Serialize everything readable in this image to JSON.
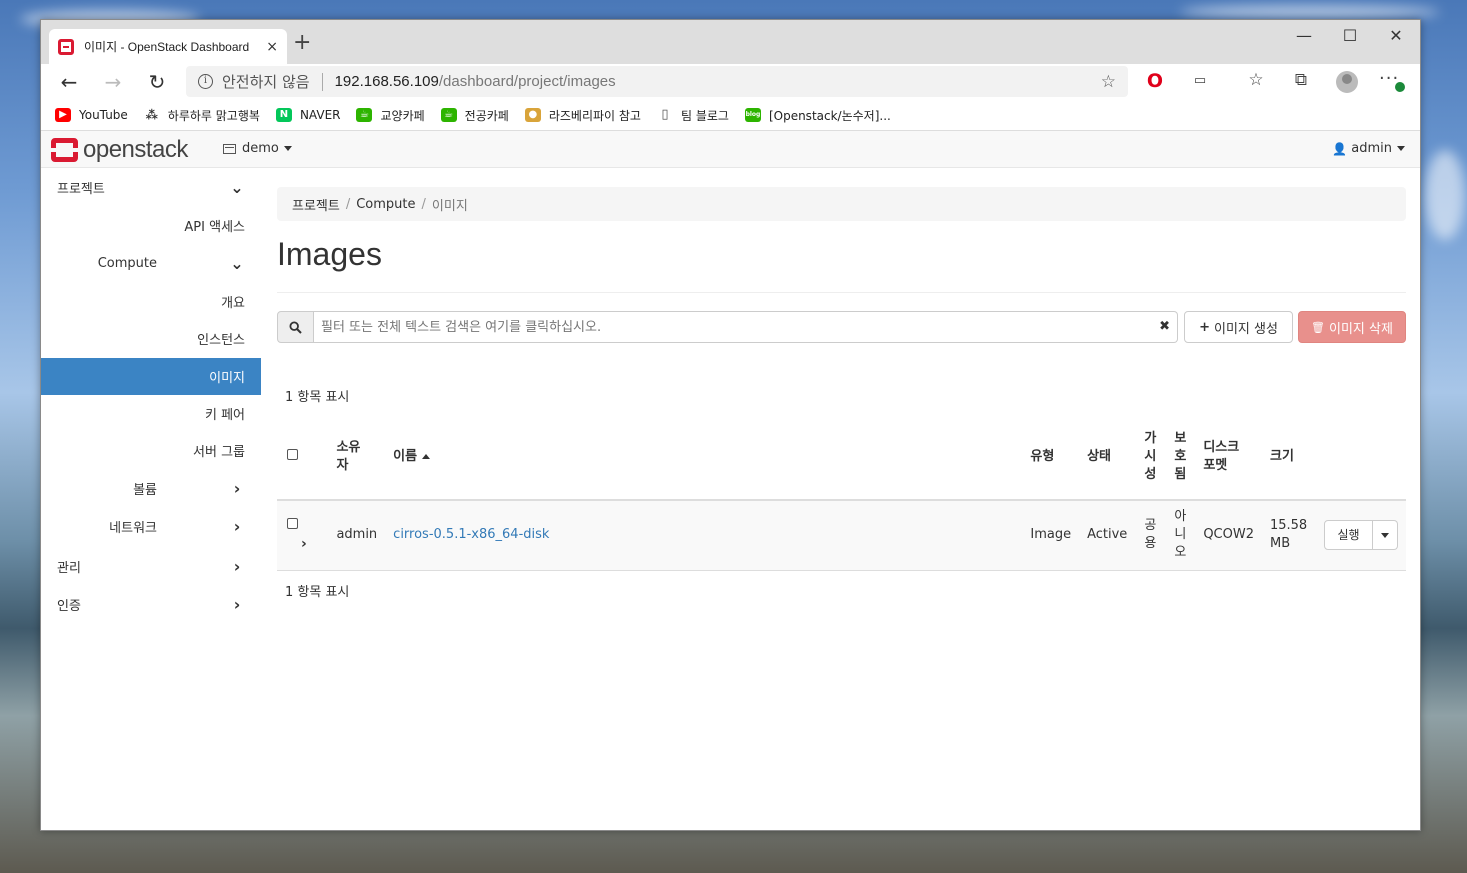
{
  "browser": {
    "tab_title": "이미지 - OpenStack Dashboard",
    "tab_close": "×",
    "new_tab": "+",
    "security_label": "안전하지 않음",
    "url_host": "192.168.56.109",
    "url_path": "/dashboard/project/images",
    "window_controls": {
      "minimize": "—",
      "maximize": "☐",
      "close": "✕"
    }
  },
  "bookmarks": [
    {
      "label": "YouTube",
      "icon": "youtube-icon",
      "color": "#ff0000"
    },
    {
      "label": "하루하루 맑고행복",
      "icon": "bookmark-icon",
      "color": "#333333"
    },
    {
      "label": "NAVER",
      "icon": "naver-icon",
      "color": "#03c75a"
    },
    {
      "label": "교양카페",
      "icon": "cafe-icon",
      "color": "#2db400"
    },
    {
      "label": "전공카페",
      "icon": "cafe-icon",
      "color": "#2db400"
    },
    {
      "label": "라즈베리파이 참고",
      "icon": "raspberry-icon",
      "color": "#d9a43a"
    },
    {
      "label": "팀 블로그",
      "icon": "page-icon",
      "color": "#555555"
    },
    {
      "label": "[Openstack/논수저]...",
      "icon": "blog-icon",
      "color": "#2db400"
    }
  ],
  "header": {
    "logo_text": "openstack",
    "project": "demo",
    "user": "admin"
  },
  "sidebar": {
    "project": "프로젝트",
    "api_access": "API 액세스",
    "compute": "Compute",
    "overview": "개요",
    "instances": "인스턴스",
    "images": "이미지",
    "keypairs": "키 페어",
    "server_groups": "서버 그룹",
    "volumes": "볼륨",
    "network": "네트워크",
    "admin": "관리",
    "identity": "인증"
  },
  "breadcrumb": {
    "project": "프로젝트",
    "compute": "Compute",
    "current": "이미지",
    "separator": "/"
  },
  "page": {
    "title": "Images",
    "search_placeholder": "필터 또는 전체 텍스트 검색은 여기를 클릭하십시오.",
    "create_button": "이미지 생성",
    "delete_button": "이미지 삭제",
    "count_top": "1 항목 표시",
    "count_bottom": "1 항목 표시"
  },
  "table": {
    "headers": {
      "owner": "소유자",
      "name": "이름",
      "type": "유형",
      "status": "상태",
      "visibility": "가시성",
      "protected": "보호됨",
      "disk_format": "디스크 포멧",
      "size": "크기"
    },
    "rows": [
      {
        "owner": "admin",
        "name": "cirros-0.5.1-x86_64-disk",
        "type": "Image",
        "status": "Active",
        "visibility": "공용",
        "protected": "아니오",
        "disk_format": "QCOW2",
        "size": "15.58 MB",
        "action": "실행"
      }
    ]
  }
}
